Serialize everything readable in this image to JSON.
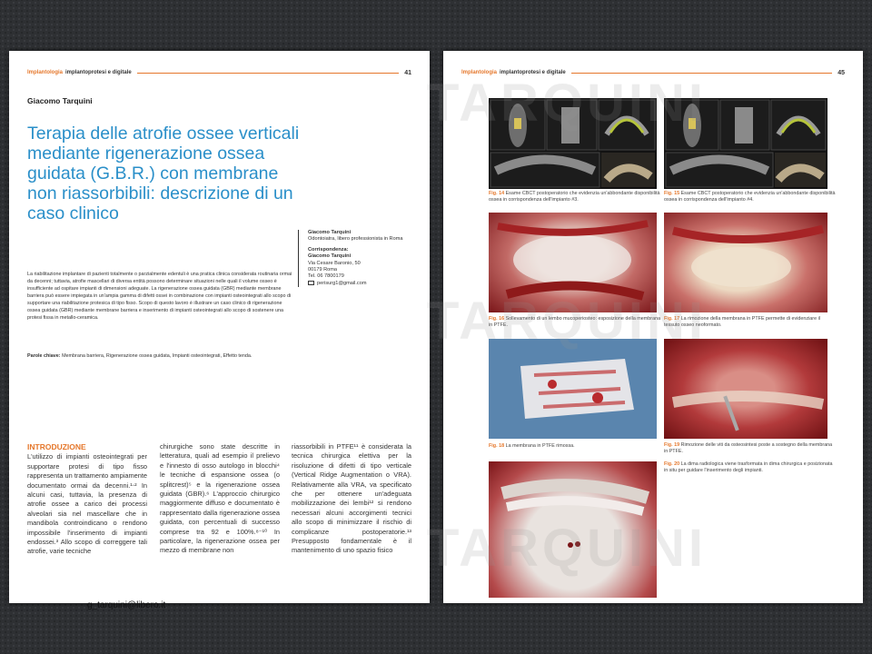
{
  "left_page": {
    "header": {
      "section": "Implantologia",
      "subsection": "implantoprotesi e digitale",
      "page_number": "41"
    },
    "author": "Giacomo Tarquini",
    "title": "Terapia delle atrofie ossee verticali mediante rigenerazione ossea guidata (G.B.R.) con membrane non riassorbibili: descrizione di un caso clinico",
    "affiliation": {
      "name": "Giacomo Tarquini",
      "role": "Odontoiatra, libero professionista in Roma",
      "corr_label": "Corrispondenza:",
      "corr_name": "Giacomo Tarquini",
      "address": "Via Cesare Baronio, 50",
      "city": "00179 Roma",
      "tel": "Tel. 06 7800179",
      "email": "perisurg1@gmail.com"
    },
    "abstract": "La riabilitazione implantare di pazienti totalmente o parzialmente edentuli è una pratica clinica considerata routinaria ormai da decenni; tuttavia, atrofie mascellari di diversa entità possono determinare situazioni nelle quali il volume osseo è insufficiente ad ospitare impianti di dimensioni adeguate. La rigenerazione ossea guidata (GBR) mediante membrane barriera può essere impiegata in un'ampia gamma di difetti ossei in combinazione con impianti osteointegrati allo scopo di supportare una riabilitazione protesica di tipo fisso. Scopo di questo lavoro è illustrare un caso clinico di rigenerazione ossea guidata (GBR) mediante membrane barriera e inserimento di impianti osteointegrati allo scopo di sostenere una protesi fissa in metallo-ceramica.",
    "keywords_label": "Parole chiave:",
    "keywords": "Membrana barriera, Rigenerazione ossea guidata, Impianti osteointegrati, Effetto tenda.",
    "intro_heading": "INTRODUZIONE",
    "col1": "L'utilizzo di impianti osteointegrati per supportare protesi di tipo fisso rappresenta un trattamento ampiamente documentato ormai da decenni.¹‧² In alcuni casi, tuttavia, la presenza di atrofie ossee a carico dei processi alveolari sia nel mascellare che in mandibola controindicano o rendono impossibile l'inserimento di impianti endossei.³ Allo scopo di correggere tali atrofie, varie tecniche",
    "col2": "chirurgiche sono state descritte in letteratura, quali ad esempio il prelievo e l'innesto di osso autologo in blocchi⁴ le tecniche di espansione ossea (o splitcrest)⁵ e la rigenerazione ossea guidata (GBR).⁶ L'approccio chirurgico maggiormente diffuso e documentato è rappresentato dalla rigenerazione ossea guidata, con percentuali di successo comprese tra 92 e 100%.⁸⁻¹⁰ In particolare, la rigenerazione ossea per mezzo di membrane non",
    "col3": "riassorbibili in PTFE¹¹ è considerata la tecnica chirurgica elettiva per la risoluzione di difetti di tipo verticale (Vertical Ridge Augmentation o VRA). Relativamente alla VRA, va specificato che per ottenere un'adeguata mobilizzazione dei lembi¹² si rendono necessari alcuni accorgimenti tecnici allo scopo di minimizzare il rischio di complicanze postoperatorie.¹³ Presupposto fondamentale è il mantenimento di uno spazio fisico"
  },
  "right_page": {
    "header": {
      "section": "Implantologia",
      "subsection": "implantoprotesi e digitale",
      "page_number": "45"
    },
    "figures": [
      {
        "label": "Fig. 14",
        "caption": "Esame CBCT postoperatorio che evidenzia un'abbondante disponibilità ossea in corrispondenza dell'impianto #3."
      },
      {
        "label": "Fig. 15",
        "caption": "Esame CBCT postoperatorio che evidenzia un'abbondante disponibilità ossea in corrispondenza dell'impianto #4."
      },
      {
        "label": "Fig. 16",
        "caption": "Sollevamento di un lembo mucoperiosteo: esposizione della membrana in PTFE."
      },
      {
        "label": "Fig. 17",
        "caption": "La rimozione della membrana in PTFE permette di evidenziare il tessuto osseo neoformato."
      },
      {
        "label": "Fig. 18",
        "caption": "La membrana in PTFE rimossa."
      },
      {
        "label": "Fig. 19",
        "caption": "Rimozione delle viti da osteosintesi poste a sostegno della membrana in PTFE."
      },
      {
        "label": "Fig. 20",
        "caption": "La dima radiologica viene trasformata in dima chirurgica e posizionata in situ per guidare l'inserimento degli impianti."
      }
    ]
  },
  "watermark": "TARQUINI",
  "footer_email": "g_tarquini@libero.it",
  "colors": {
    "accent_orange": "#e5772b",
    "title_blue": "#2a8fc9",
    "background": "#2e3033"
  }
}
